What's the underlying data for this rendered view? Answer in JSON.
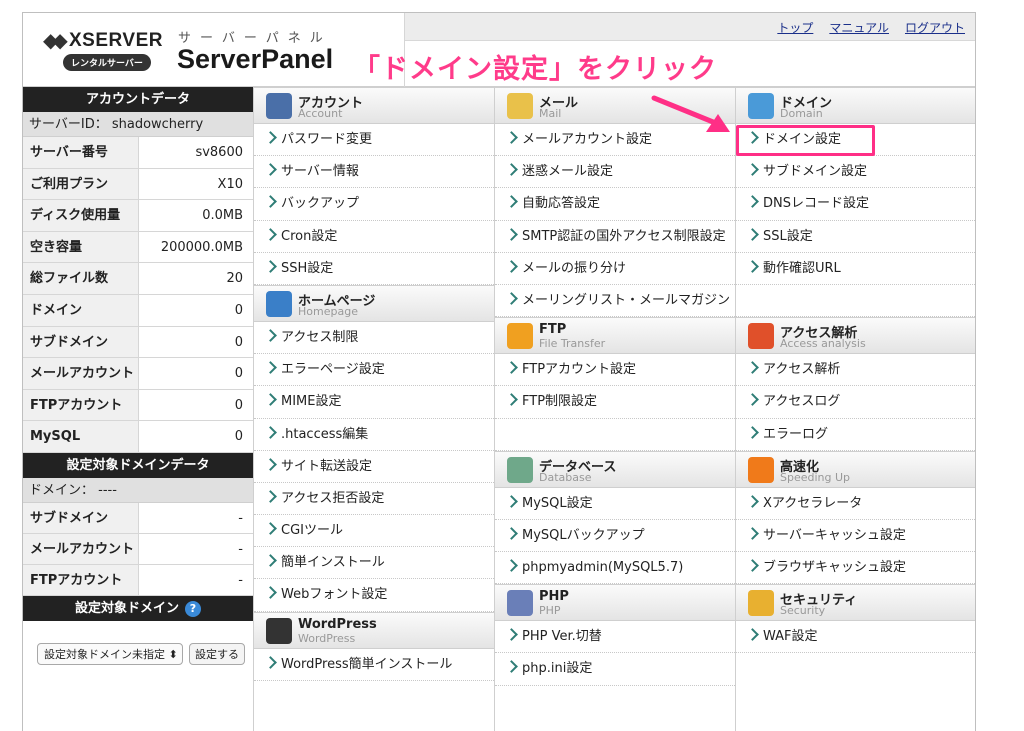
{
  "header": {
    "logo_name": "XSERVER",
    "logo_rental": "レンタルサーバー",
    "panel_kana": "サーバーパネル",
    "panel_name": "ServerPanel",
    "callout": "「ドメイン設定」をクリック",
    "links": [
      "トップ",
      "マニュアル",
      "ログアウト"
    ]
  },
  "account_data": {
    "title": "アカウントデータ",
    "server_id": "サーバーID： shadowcherry",
    "rows": [
      {
        "k": "サーバー番号",
        "v": "sv8600"
      },
      {
        "k": "ご利用プラン",
        "v": "X10"
      },
      {
        "k": "ディスク使用量",
        "v": "0.0MB"
      },
      {
        "k": "空き容量",
        "v": "200000.0MB"
      },
      {
        "k": "総ファイル数",
        "v": "20"
      },
      {
        "k": "ドメイン",
        "v": "0"
      },
      {
        "k": "サブドメイン",
        "v": "0"
      },
      {
        "k": "メールアカウント",
        "v": "0"
      },
      {
        "k": "FTPアカウント",
        "v": "0"
      },
      {
        "k": "MySQL",
        "v": "0"
      }
    ]
  },
  "target_domain_data": {
    "title": "設定対象ドメインデータ",
    "domain": "ドメイン： ----",
    "rows": [
      {
        "k": "サブドメイン",
        "v": "-"
      },
      {
        "k": "メールアカウント",
        "v": "-"
      },
      {
        "k": "FTPアカウント",
        "v": "-"
      }
    ]
  },
  "target_domain": {
    "title": "設定対象ドメイン",
    "select_value": "設定対象ドメイン未指定",
    "button": "設定する"
  },
  "columns": [
    {
      "sections": [
        {
          "title": "アカウント",
          "en": "Account",
          "icon": "person-icon",
          "color": "#4a6fa8",
          "rows": 5,
          "items": [
            "パスワード変更",
            "サーバー情報",
            "バックアップ",
            "Cron設定",
            "SSH設定"
          ]
        },
        {
          "title": "ホームページ",
          "en": "Homepage",
          "icon": "homepage-icon",
          "color": "#3a7fc8",
          "rows": 9,
          "items": [
            "アクセス制限",
            "エラーページ設定",
            "MIME設定",
            ".htaccess編集",
            "サイト転送設定",
            "アクセス拒否設定",
            "CGIツール",
            "簡単インストール",
            "Webフォント設定"
          ]
        },
        {
          "title": "WordPress",
          "en": "WordPress",
          "icon": "wordpress-icon",
          "color": "#333333",
          "rows": 1,
          "items": [
            "WordPress簡単インストール"
          ]
        }
      ]
    },
    {
      "sections": [
        {
          "title": "メール",
          "en": "Mail",
          "icon": "mail-icon",
          "color": "#e9c14a",
          "rows": 6,
          "items": [
            "メールアカウント設定",
            "迷惑メール設定",
            "自動応答設定",
            "SMTP認証の国外アクセス制限設定",
            "メールの振り分け",
            "メーリングリスト・メールマガジン"
          ]
        },
        {
          "title": "FTP",
          "en": "File Transfer",
          "icon": "folder-icon",
          "color": "#f0a020",
          "rows": 3,
          "items": [
            "FTPアカウント設定",
            "FTP制限設定"
          ]
        },
        {
          "title": "データベース",
          "en": "Database",
          "icon": "database-icon",
          "color": "#6fa88a",
          "rows": 3,
          "items": [
            "MySQL設定",
            "MySQLバックアップ",
            "phpmyadmin(MySQL5.7)"
          ]
        },
        {
          "title": "PHP",
          "en": "PHP",
          "icon": "php-icon",
          "color": "#6a7fb8",
          "rows": 2,
          "items": [
            "PHP Ver.切替",
            "php.ini設定"
          ]
        }
      ]
    },
    {
      "sections": [
        {
          "title": "ドメイン",
          "en": "Domain",
          "icon": "globe-icon",
          "color": "#4a9ad8",
          "rows": 6,
          "items": [
            "ドメイン設定",
            "サブドメイン設定",
            "DNSレコード設定",
            "SSL設定",
            "動作確認URL"
          ]
        },
        {
          "title": "アクセス解析",
          "en": "Access analysis",
          "icon": "chart-icon",
          "color": "#e0502a",
          "rows": 3,
          "items": [
            "アクセス解析",
            "アクセスログ",
            "エラーログ"
          ]
        },
        {
          "title": "高速化",
          "en": "Speeding Up",
          "icon": "speed-icon",
          "color": "#f07a1a",
          "rows": 3,
          "items": [
            "Xアクセラレータ",
            "サーバーキャッシュ設定",
            "ブラウザキャッシュ設定"
          ]
        },
        {
          "title": "セキュリティ",
          "en": "Security",
          "icon": "shield-icon",
          "color": "#e8b030",
          "rows": 1,
          "items": [
            "WAF設定"
          ]
        }
      ]
    }
  ],
  "highlight_color": "#ff2f86"
}
